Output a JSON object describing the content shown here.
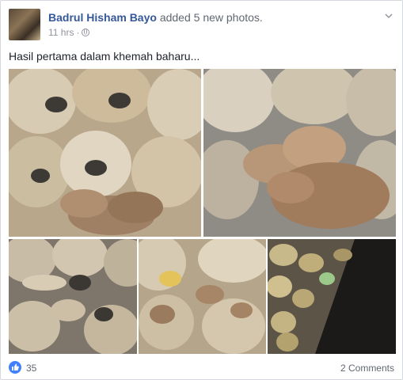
{
  "post": {
    "author": "Badrul Hisham Bayo",
    "action": "added 5 new photos.",
    "time": "11 hrs",
    "separator": "·",
    "caption": "Hasil pertama dalam khemah baharu...",
    "privacy_icon": "globe-icon",
    "menu_icon": "chevron-down-icon"
  },
  "footer": {
    "like_icon": "thumbs-up-icon",
    "like_count": "35",
    "comments": "2 Comments"
  },
  "colors": {
    "author": "#365899",
    "like": "#4080ff",
    "muted": "#90949c"
  }
}
